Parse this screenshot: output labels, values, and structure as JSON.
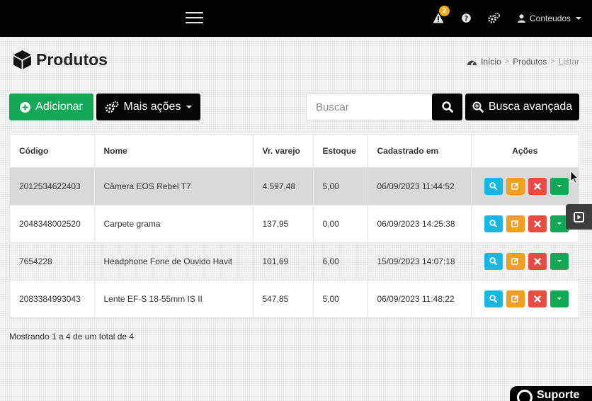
{
  "topbar": {
    "notification_count": "2",
    "user_name": "Conteudos"
  },
  "header": {
    "title": "Produtos",
    "breadcrumb": [
      "Início",
      "Produtos",
      "Listar"
    ]
  },
  "toolbar": {
    "add_label": "Adicionar",
    "more_actions_label": "Mais ações",
    "search_placeholder": "Buscar",
    "advanced_search_label": "Busca avançada"
  },
  "table": {
    "columns": [
      "Código",
      "Nome",
      "Vr. varejo",
      "Estoque",
      "Cadastrado em",
      "Ações"
    ],
    "rows": [
      {
        "codigo": "2012534622403",
        "nome": "Câmera EOS Rebel T7",
        "valor": "4.597,48",
        "estoque": "5,00",
        "cadastrado": "06/09/2023 11:44:52"
      },
      {
        "codigo": "2048348002520",
        "nome": "Carpete grama",
        "valor": "137,95",
        "estoque": "0,00",
        "cadastrado": "06/09/2023 14:25:38"
      },
      {
        "codigo": "7654228",
        "nome": "Headphone Fone de Ouvido Havit",
        "valor": "101,69",
        "estoque": "6,00",
        "cadastrado": "15/09/2023 14:07:18"
      },
      {
        "codigo": "2083384993043",
        "nome": "Lente EF-S 18-55mm IS II",
        "valor": "547,85",
        "estoque": "5,00",
        "cadastrado": "06/09/2023 11:48:22"
      }
    ]
  },
  "footer": {
    "pagination_info": "Mostrando 1 a 4 de um total de 4",
    "support_label": "Suporte"
  },
  "colors": {
    "topbar": "#020202",
    "add_button": "#13a858",
    "view_action": "#17b6e3",
    "edit_action": "#f0a020",
    "delete_action": "#ec4b42",
    "more_action": "#13a858",
    "badge": "#f0ad1a"
  },
  "icons": [
    "menu-icon",
    "warning-icon",
    "help-icon",
    "cogs-icon",
    "user-icon",
    "cube-icon",
    "dashboard-icon",
    "plus-circle-icon",
    "search-icon",
    "zoom-plus-icon",
    "edit-icon",
    "close-icon",
    "caret-down-icon",
    "play-square-icon",
    "chat-icon"
  ]
}
